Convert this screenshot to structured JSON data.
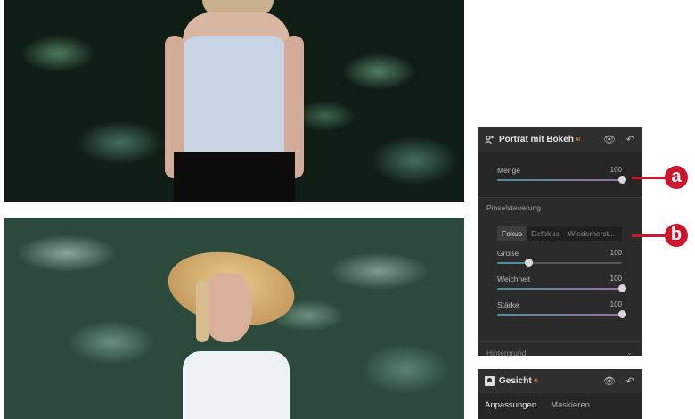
{
  "panel_bokeh": {
    "title": "Porträt mit Bokeh",
    "ai_badge": "AI",
    "menge": {
      "label": "Menge",
      "value": "100",
      "fraction": 1.0
    },
    "section_label": "Pinselsteuerung",
    "brush_modes": [
      "Fokus",
      "Defokus",
      "Wiederherst..."
    ],
    "active_mode": "Fokus",
    "sliders": [
      {
        "label": "Größe",
        "value": "100",
        "fraction": 0.25
      },
      {
        "label": "Weichheit",
        "value": "100",
        "fraction": 1.0
      },
      {
        "label": "Stärke",
        "value": "100",
        "fraction": 1.0
      }
    ],
    "collapsed_section": "Hintergrund"
  },
  "panel_face": {
    "title": "Gesicht",
    "ai_badge": "AI",
    "tabs": [
      "Anpassungen",
      "Maskieren"
    ]
  },
  "callouts": {
    "a": "a",
    "b": "b"
  },
  "colors": {
    "callout": "#d0142c",
    "ai_badge": "#e0912e"
  }
}
